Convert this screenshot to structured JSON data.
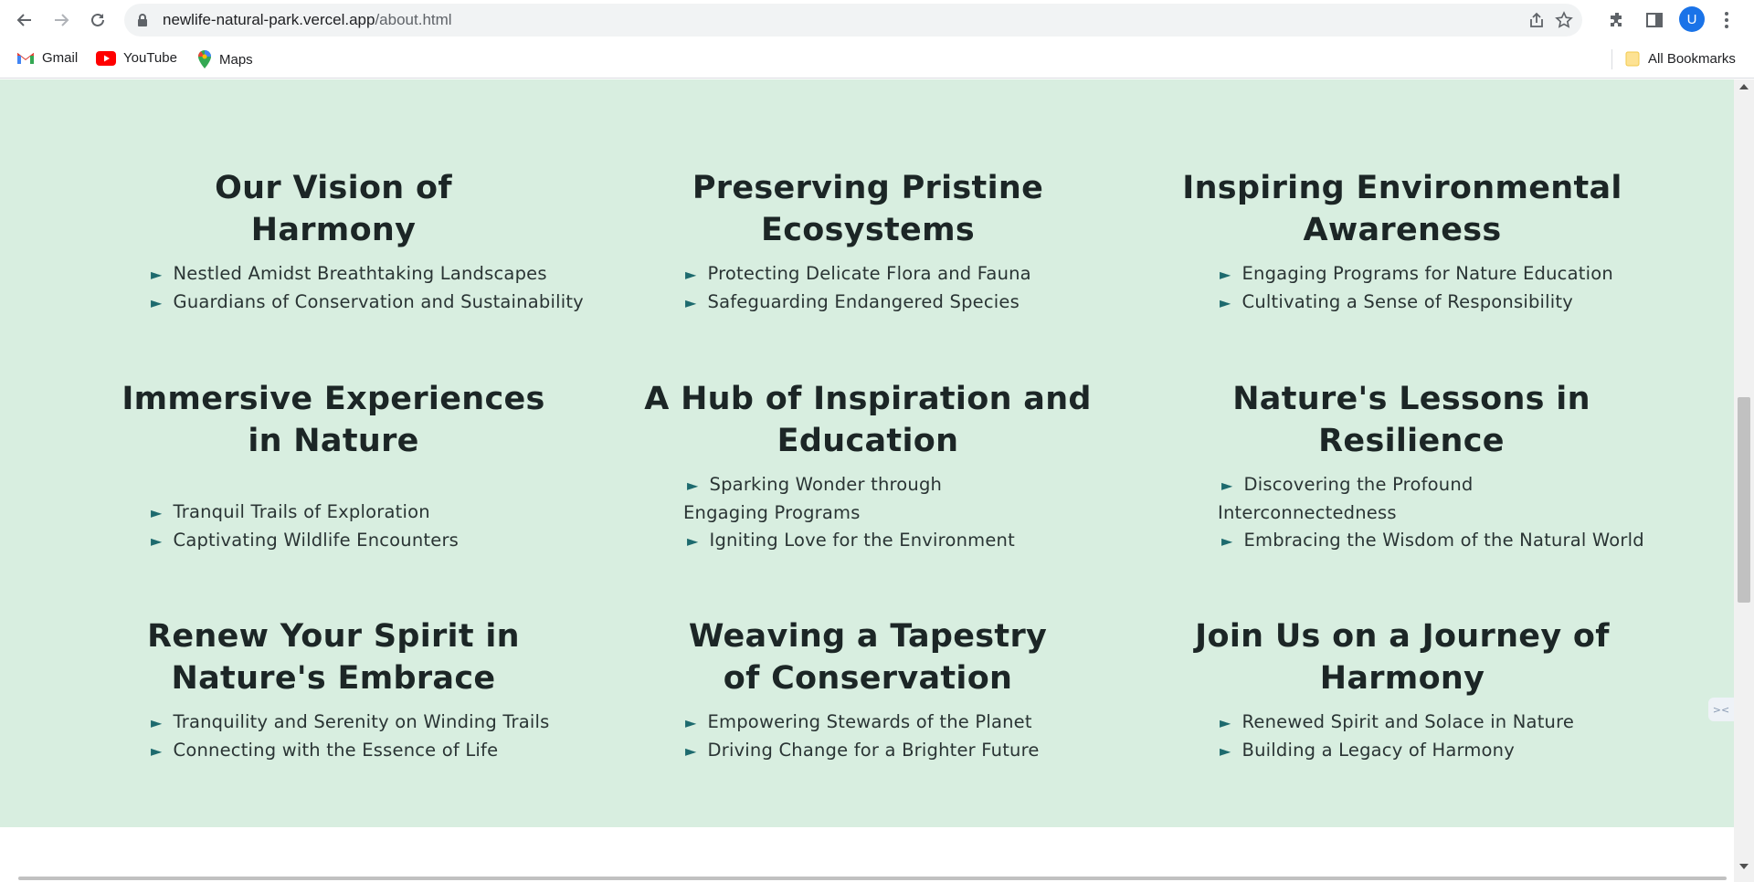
{
  "browser": {
    "url_host": "newlife-natural-park.vercel.app",
    "url_path": "/about.html",
    "profile_initial": "U",
    "bookmarks": [
      {
        "label": "Gmail",
        "icon": "gmail-icon"
      },
      {
        "label": "YouTube",
        "icon": "youtube-icon"
      },
      {
        "label": "Maps",
        "icon": "maps-icon"
      }
    ],
    "all_bookmarks_label": "All Bookmarks"
  },
  "colors": {
    "section_bg": "#d8eee0",
    "heading": "#1c2626",
    "bullet_arrow": "#1d6a6e"
  },
  "cards": [
    {
      "title": "Our Vision of Harmony",
      "items": [
        "Nestled Amidst Breathtaking Landscapes",
        "Guardians of Conservation and Sustainability"
      ]
    },
    {
      "title": "Preserving Pristine Ecosystems",
      "items": [
        "Protecting Delicate Flora and Fauna",
        "Safeguarding Endangered Species"
      ]
    },
    {
      "title": "Inspiring Environmental Awareness",
      "items": [
        "Engaging Programs for Nature Education",
        "Cultivating a Sense of Responsibility"
      ]
    },
    {
      "title": "Immersive Experiences in Nature",
      "items": [
        "Tranquil Trails of Exploration",
        "Captivating Wildlife Encounters"
      ]
    },
    {
      "title": "A Hub of Inspiration and Education",
      "items": [
        "Sparking Wonder through Engaging Programs",
        "Igniting Love for the Environment"
      ]
    },
    {
      "title": "Nature's Lessons in Resilience",
      "items": [
        "Discovering the Profound Interconnectedness",
        "Embracing the Wisdom of the Natural World"
      ]
    },
    {
      "title": "Renew Your Spirit in Nature's Embrace",
      "items": [
        "Tranquility and Serenity on Winding Trails",
        "Connecting with the Essence of Life"
      ]
    },
    {
      "title": "Weaving a Tapestry of Conservation",
      "items": [
        "Empowering Stewards of the Planet",
        "Driving Change for a Brighter Future"
      ]
    },
    {
      "title": "Join Us on a Journey of Harmony",
      "items": [
        "Renewed Spirit and Solace in Nature",
        "Building a Legacy of Harmony"
      ]
    }
  ],
  "bullet_glyph": "►"
}
